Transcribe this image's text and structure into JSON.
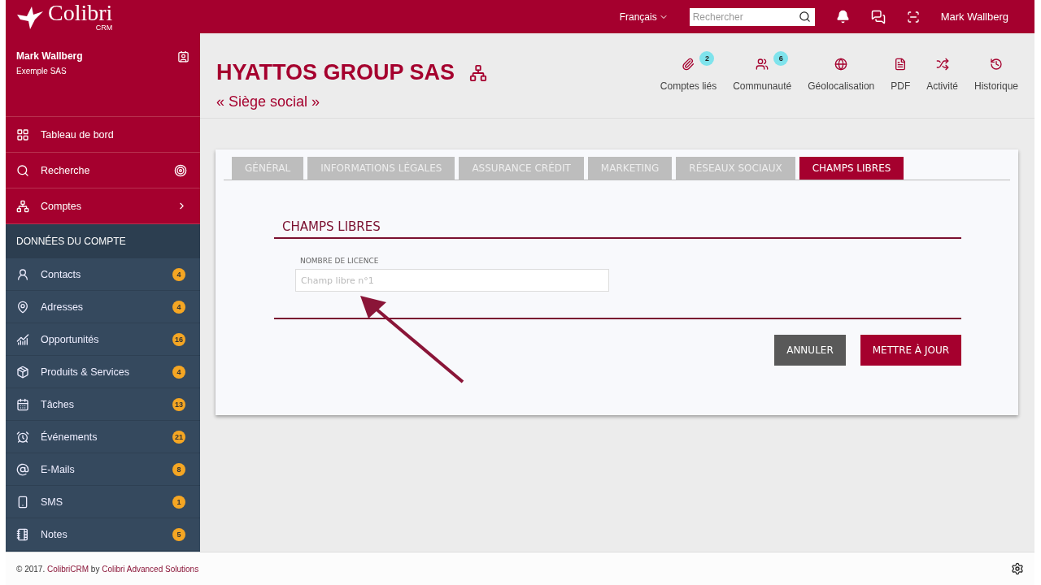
{
  "topbar": {
    "logo": "Colibri",
    "logo_sub": "CRM",
    "language": "Français",
    "search": {
      "placeholder": "Rechercher"
    },
    "user": "Mark Wallberg"
  },
  "sidebar": {
    "user": {
      "name": "Mark Wallberg",
      "company": "Exemple SAS"
    },
    "nav": [
      {
        "kind": "grid",
        "label": "Tableau de bord"
      },
      {
        "kind": "search",
        "label": "Recherche"
      },
      {
        "kind": "accounts",
        "label": "Comptes"
      }
    ],
    "section": "DONNÉES DU COMPTE",
    "items": [
      {
        "kind": "contact",
        "label": "Contacts",
        "count": "4"
      },
      {
        "kind": "address",
        "label": "Adresses",
        "count": "4"
      },
      {
        "kind": "chart",
        "label": "Opportunités",
        "count": "16"
      },
      {
        "kind": "box",
        "label": "Produits & Services",
        "count": "4"
      },
      {
        "kind": "calendar",
        "label": "Tâches",
        "count": "13"
      },
      {
        "kind": "alarm",
        "label": "Événements",
        "count": "21"
      },
      {
        "kind": "at",
        "label": "E-Mails",
        "count": "8"
      },
      {
        "kind": "phone",
        "label": "SMS",
        "count": "1"
      },
      {
        "kind": "note",
        "label": "Notes",
        "count": "5"
      }
    ]
  },
  "header": {
    "title": "HYATTOS GROUP SAS",
    "subtitle": "« Siège social »",
    "actions": [
      {
        "kind": "clip",
        "label": "Comptes liés",
        "count": "2"
      },
      {
        "kind": "users",
        "label": "Communauté",
        "count": "6"
      },
      {
        "kind": "globe",
        "label": "Géolocalisation"
      },
      {
        "kind": "pdf",
        "label": "PDF"
      },
      {
        "kind": "shuffle",
        "label": "Activité"
      },
      {
        "kind": "history",
        "label": "Historique"
      }
    ]
  },
  "tabs": [
    {
      "label": "GÉNÉRAL",
      "selected": false
    },
    {
      "label": "INFORMATIONS LÉGALES",
      "selected": false
    },
    {
      "label": "ASSURANCE CRÉDIT",
      "selected": false
    },
    {
      "label": "MARKETING",
      "selected": false
    },
    {
      "label": "RÉSEAUX SOCIAUX",
      "selected": false
    },
    {
      "label": "CHAMPS LIBRES",
      "selected": true
    }
  ],
  "form": {
    "title": "CHAMPS LIBRES",
    "field": {
      "label": "NOMBRE DE LICENCE",
      "placeholder": "Champ libre n°1"
    },
    "buttons": [
      {
        "kind": "secondary",
        "label": "ANNULER"
      },
      {
        "kind": "primary",
        "label": "METTRE À JOUR"
      }
    ]
  },
  "footer": {
    "year": "© 2017.",
    "product": "ColibriCRM",
    "by": "by",
    "company": "Colibri Advanced Solutions"
  }
}
